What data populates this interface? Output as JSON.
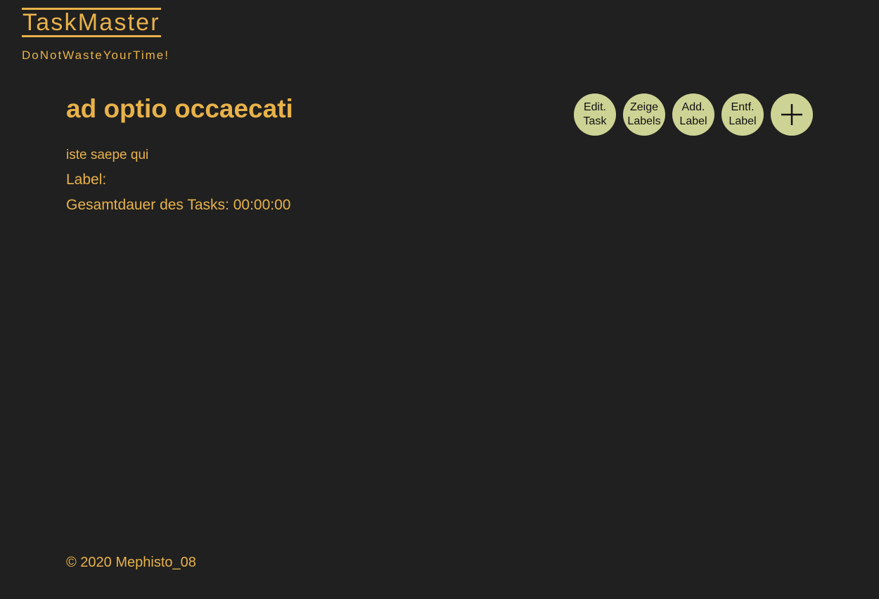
{
  "header": {
    "logo": "TaskMaster",
    "tagline": "DoNotWasteYourTime!"
  },
  "task": {
    "title": "ad optio occaecati",
    "description": "iste saepe qui",
    "label_text": "Label:",
    "duration_text": "Gesamtdauer des Tasks: 00:00:00"
  },
  "actions": {
    "edit_task": [
      "Edit.",
      "Task"
    ],
    "show_labels": [
      "Zeige",
      "Labels"
    ],
    "add_label": [
      "Add.",
      "Label"
    ],
    "remove_label": [
      "Entf.",
      "Label"
    ],
    "add_icon": "plus-icon"
  },
  "footer": {
    "copyright": "© 2020 Mephisto_08"
  },
  "colors": {
    "background": "#202020",
    "accent": "#e8b24a",
    "button": "#cdd394"
  }
}
